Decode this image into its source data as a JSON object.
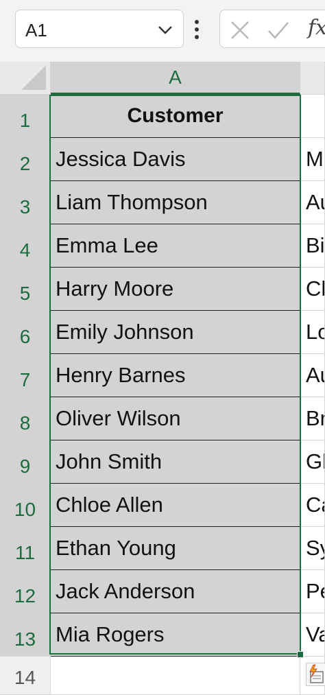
{
  "formula_bar": {
    "name_box": "A1",
    "fx_label": "fx"
  },
  "columns": [
    "A",
    ""
  ],
  "rows": [
    {
      "num": "1",
      "a": "Customer",
      "b": ""
    },
    {
      "num": "2",
      "a": "Jessica Davis",
      "b": "M"
    },
    {
      "num": "3",
      "a": "Liam Thompson",
      "b": "Au"
    },
    {
      "num": "4",
      "a": "Emma Lee",
      "b": "Bi"
    },
    {
      "num": "5",
      "a": "Harry Moore",
      "b": "Ch"
    },
    {
      "num": "6",
      "a": "Emily Johnson",
      "b": "Lo"
    },
    {
      "num": "7",
      "a": "Henry Barnes",
      "b": "Au"
    },
    {
      "num": "8",
      "a": "Oliver Wilson",
      "b": "Br"
    },
    {
      "num": "9",
      "a": "John Smith",
      "b": "Gl"
    },
    {
      "num": "10",
      "a": "Chloe Allen",
      "b": "Ca"
    },
    {
      "num": "11",
      "a": "Ethan Young",
      "b": "Sy"
    },
    {
      "num": "12",
      "a": "Jack Anderson",
      "b": "Pe"
    },
    {
      "num": "13",
      "a": "Mia Rogers",
      "b": "Va"
    },
    {
      "num": "14",
      "a": "",
      "b": ""
    }
  ],
  "colors": {
    "selection_accent": "#1e6b3f",
    "selected_fill": "#d3d3d3"
  },
  "icons": [
    "chevron-down-icon",
    "more-options-icon",
    "cancel-icon",
    "enter-check-icon",
    "fx-icon",
    "select-all-triangle-icon",
    "quick-analysis-icon"
  ]
}
